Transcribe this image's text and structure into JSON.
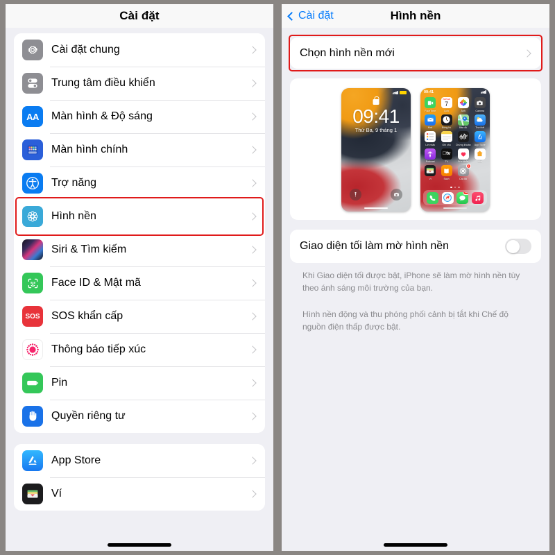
{
  "left_panel": {
    "nav_title": "Cài đặt",
    "groups": [
      {
        "items": [
          {
            "label": "Cài đặt chung",
            "icon": "gear-icon"
          },
          {
            "label": "Trung tâm điều khiển",
            "icon": "control-center-icon"
          },
          {
            "label": "Màn hình & Độ sáng",
            "icon": "display-brightness-icon"
          },
          {
            "label": "Màn hình chính",
            "icon": "home-screen-icon"
          },
          {
            "label": "Trợ năng",
            "icon": "accessibility-icon"
          },
          {
            "label": "Hình nền",
            "icon": "wallpaper-icon",
            "highlighted": true
          },
          {
            "label": "Siri & Tìm kiếm",
            "icon": "siri-icon"
          },
          {
            "label": "Face ID & Mật mã",
            "icon": "face-id-icon"
          },
          {
            "label": "SOS khẩn cấp",
            "icon": "sos-icon"
          },
          {
            "label": "Thông báo tiếp xúc",
            "icon": "exposure-notification-icon"
          },
          {
            "label": "Pin",
            "icon": "battery-icon"
          },
          {
            "label": "Quyền riêng tư",
            "icon": "privacy-hand-icon"
          }
        ]
      },
      {
        "items": [
          {
            "label": "App Store",
            "icon": "app-store-icon"
          },
          {
            "label": "Ví",
            "icon": "wallet-icon"
          }
        ]
      }
    ]
  },
  "right_panel": {
    "back_label": "Cài đặt",
    "nav_title": "Hình nền",
    "choose_row": {
      "label": "Chọn hình nền mới",
      "highlighted": true
    },
    "previews": {
      "lock_screen": {
        "time": "09:41",
        "date": "Thứ Ba, 9 tháng 1",
        "lock_icon": "lock-icon",
        "flashlight_icon": "flashlight-icon",
        "camera_icon": "camera-icon"
      },
      "home_screen": {
        "status_time": "09:41",
        "apps": [
          {
            "label": "FaceTime",
            "icon": "facetime-icon",
            "color": "#3dd35f"
          },
          {
            "label": "Lịch",
            "icon": "calendar-icon",
            "color": "#ffffff",
            "day": "7",
            "weekday": "THỨ HAI"
          },
          {
            "label": "Ảnh",
            "icon": "photos-icon",
            "color": "#ffffff"
          },
          {
            "label": "Camera",
            "icon": "camera-icon",
            "color": "#3a3a3c"
          },
          {
            "label": "Mail",
            "icon": "mail-icon",
            "color": "#2f7cf6"
          },
          {
            "label": "Đồng hồ",
            "icon": "clock-icon",
            "color": "#1c1c1e"
          },
          {
            "label": "Bản đồ",
            "icon": "maps-icon",
            "color": "#63d26a"
          },
          {
            "label": "Thời tiết",
            "icon": "weather-icon",
            "color": "#2f9bf5"
          },
          {
            "label": "Lời nhắc",
            "icon": "reminders-icon",
            "color": "#ffffff"
          },
          {
            "label": "Ghi chú",
            "icon": "notes-icon",
            "color": "#fdd835"
          },
          {
            "label": "Chứng khoán",
            "icon": "stocks-icon",
            "color": "#1c1c1e"
          },
          {
            "label": "App Store",
            "icon": "app-store-icon",
            "color": "#1a8cff"
          },
          {
            "label": "Podcast",
            "icon": "podcasts-icon",
            "color": "#9333d6"
          },
          {
            "label": "TV",
            "icon": "tv-icon",
            "color": "#111111"
          },
          {
            "label": "Sức khỏe",
            "icon": "health-icon",
            "color": "#ffffff"
          },
          {
            "label": "Nhà",
            "icon": "home-app-icon",
            "color": "#ffffff"
          },
          {
            "label": "Ví",
            "icon": "wallet-icon",
            "color": "#1c1c1e"
          },
          {
            "label": "Sách",
            "icon": "books-icon",
            "color": "#ff9500"
          },
          {
            "label": "Cài đặt",
            "icon": "settings-icon",
            "color": "#9a9a9e",
            "badge": "2"
          }
        ],
        "dock": [
          {
            "label": "Phone",
            "icon": "phone-icon",
            "color": "#3dd35f"
          },
          {
            "label": "Safari",
            "icon": "safari-icon",
            "color": "#ffffff"
          },
          {
            "label": "Messages",
            "icon": "messages-icon",
            "color": "#3dd35f",
            "badge": "124"
          },
          {
            "label": "Music",
            "icon": "music-icon",
            "color": "#fb3a5d"
          }
        ],
        "page_dots": 3,
        "active_dot": 0
      }
    },
    "dark_toggle_row": {
      "label": "Giao diện tối làm mờ hình nền",
      "value": "off"
    },
    "description_1": "Khi Giao diện tối được bật, iPhone sẽ làm mờ hình nền tùy theo ánh sáng môi trường của bạn.",
    "description_2": "Hình nền động và thu phóng phối cảnh bị tắt khi Chế độ nguồn điện thấp được bật."
  },
  "colors": {
    "highlight": "#e01a1a",
    "accent": "#067cfb",
    "background": "#efeff4",
    "frame": "#8a8683"
  }
}
